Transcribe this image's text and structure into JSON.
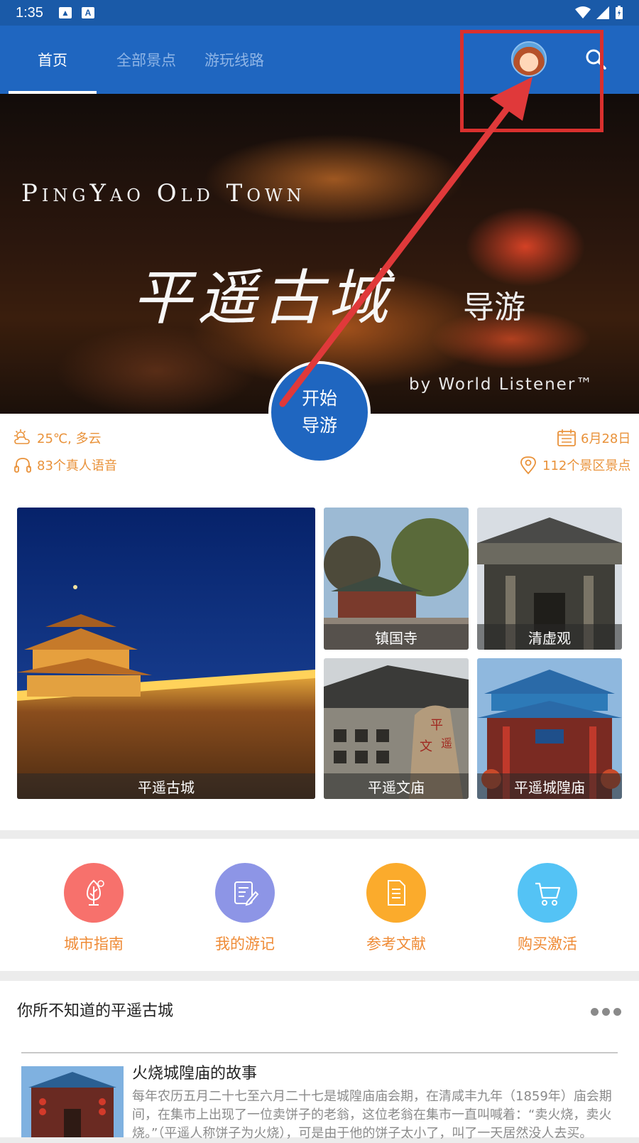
{
  "status_bar": {
    "time": "1:35",
    "text_icon": "A"
  },
  "nav": {
    "tabs": [
      "首页",
      "全部景点",
      "游玩线路"
    ],
    "active_tab": 0,
    "colors": {
      "bar": "#1f66c0",
      "inactive": "#8fb5e6"
    }
  },
  "banner": {
    "english_title": "PingYao Old Town",
    "chinese_title": "平遥古城",
    "subtitle": "导游",
    "credit": "by World Listener™"
  },
  "start_button": {
    "line1": "开始",
    "line2": "导游"
  },
  "info": {
    "weather": "25℃, 多云",
    "voices": "83个真人语音",
    "date": "6月28日",
    "spots": "112个景区景点"
  },
  "attractions": [
    {
      "name": "平遥古城"
    },
    {
      "name": "镇国寺"
    },
    {
      "name": "清虚观"
    },
    {
      "name": "平遥文庙"
    },
    {
      "name": "平遥城隍庙"
    }
  ],
  "menu": [
    {
      "label": "城市指南",
      "icon": "city-guide-icon",
      "color": "#f7716c"
    },
    {
      "label": "我的游记",
      "icon": "travel-notes-icon",
      "color": "#8d95e6"
    },
    {
      "label": "参考文献",
      "icon": "document-icon",
      "color": "#fbab2c"
    },
    {
      "label": "购买激活",
      "icon": "cart-icon",
      "color": "#54c3f5"
    }
  ],
  "section": {
    "title": "你所不知道的平遥古城",
    "article": {
      "title": "火烧城隍庙的故事",
      "body": "每年农历五月二十七至六月二十七是城隍庙庙会期，在清咸丰九年（1859年）庙会期间，在集市上出现了一位卖饼子的老翁，这位老翁在集市一直叫喊着：“卖火烧，卖火烧。”（平遥人称饼子为火烧），可是由于他的饼子太小了，叫了一天居然没人去买。"
    }
  },
  "annotation": {
    "color": "#d9302e"
  }
}
